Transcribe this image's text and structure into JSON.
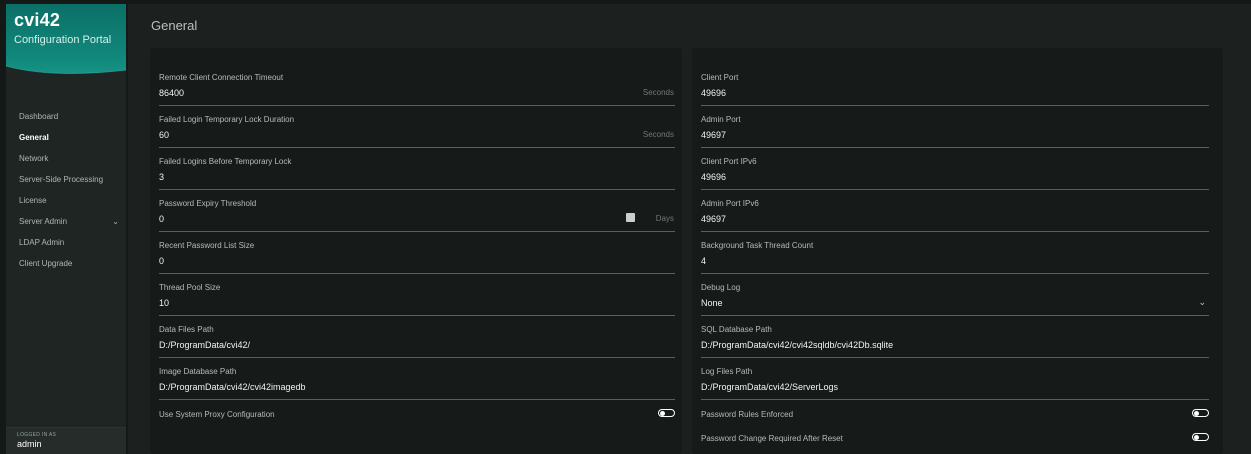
{
  "sidebar": {
    "brand": "cvi42",
    "subtitle": "Configuration Portal",
    "items": [
      {
        "label": "Dashboard"
      },
      {
        "label": "General"
      },
      {
        "label": "Network"
      },
      {
        "label": "Server-Side Processing"
      },
      {
        "label": "License"
      },
      {
        "label": "Server Admin"
      },
      {
        "label": "LDAP Admin"
      },
      {
        "label": "Client Upgrade"
      }
    ],
    "active_item": "General",
    "logged_in_label": "LOGGED IN AS",
    "logged_in_user": "admin"
  },
  "page": {
    "title": "General"
  },
  "left_fields": [
    {
      "label": "Remote Client Connection Timeout",
      "value": "86400",
      "suffix": "Seconds"
    },
    {
      "label": "Failed Login Temporary Lock Duration",
      "value": "60",
      "suffix": "Seconds"
    },
    {
      "label": "Failed Logins Before Temporary Lock",
      "value": "3"
    },
    {
      "label": "Password Expiry Threshold",
      "value": "0",
      "suffix": "Days"
    },
    {
      "label": "Recent Password List Size",
      "value": "0"
    },
    {
      "label": "Thread Pool Size",
      "value": "10"
    },
    {
      "label": "Data Files Path",
      "value": "D:/ProgramData/cvi42/"
    },
    {
      "label": "Image Database Path",
      "value": "D:/ProgramData/cvi42/cvi42imagedb"
    }
  ],
  "left_toggles": [
    {
      "label": "Use System Proxy Configuration",
      "on": false
    }
  ],
  "right_fields": [
    {
      "label": "Client Port",
      "value": "49696"
    },
    {
      "label": "Admin Port",
      "value": "49697"
    },
    {
      "label": "Client Port IPv6",
      "value": "49696"
    },
    {
      "label": "Admin Port IPv6",
      "value": "49697"
    },
    {
      "label": "Background Task Thread Count",
      "value": "4"
    },
    {
      "label": "Debug Log",
      "value": "None"
    },
    {
      "label": "SQL Database Path",
      "value": "D:/ProgramData/cvi42/cvi42sqldb/cvi42Db.sqlite"
    },
    {
      "label": "Log Files Path",
      "value": "D:/ProgramData/cvi42/ServerLogs"
    }
  ],
  "right_toggles": [
    {
      "label": "Password Rules Enforced",
      "on": false
    },
    {
      "label": "Password Change Required After Reset",
      "on": false
    }
  ],
  "icons": {
    "calendar": "calendar-icon",
    "select_arrow": "chevron-down-icon",
    "submenu_arrow": "chevron-down-icon"
  },
  "colors": {
    "accent": "#12887c",
    "background": "#1c201f",
    "card": "#161a19"
  }
}
